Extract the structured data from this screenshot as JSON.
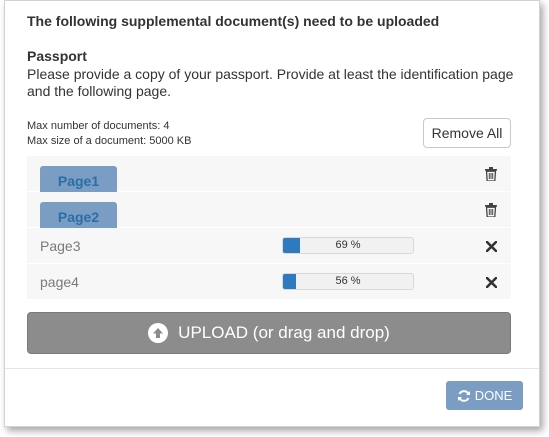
{
  "dialog": {
    "title": "The following supplemental document(s) need to be uploaded",
    "document_name": "Passport",
    "document_description": "Please provide a copy of your passport. Provide at least the identification page and the following page.",
    "max_documents": "Max number of documents: 4",
    "max_size": "Max size of a document: 5000 KB",
    "remove_all_label": "Remove All",
    "files": [
      {
        "name": "Page1",
        "status": "uploaded",
        "icon": "trash-icon"
      },
      {
        "name": "Page2",
        "status": "uploaded",
        "icon": "trash-icon"
      },
      {
        "name": "Page3",
        "status": "uploading",
        "progress": 69,
        "progress_label": "69 %",
        "icon": "close-icon"
      },
      {
        "name": "page4",
        "status": "uploading",
        "progress": 56,
        "progress_label": "56 %",
        "icon": "close-icon"
      }
    ],
    "upload_label": "UPLOAD (or drag and drop)",
    "upload_icon": "upload-arrow-icon",
    "done_label": "DONE",
    "done_icon": "refresh-icon",
    "colors": {
      "link_blue": "#2a6ea6",
      "progress_fill": "#2f7abf",
      "upload_button": "#8c8c8c",
      "done_button": "#7b9dc3"
    }
  }
}
